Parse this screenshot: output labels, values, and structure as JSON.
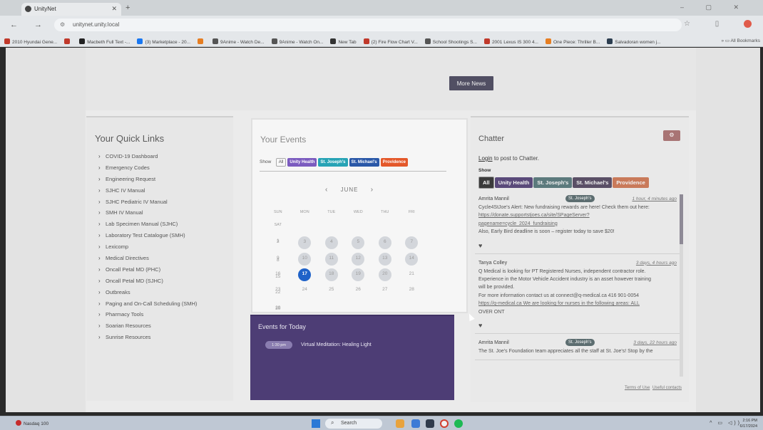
{
  "browser": {
    "tab_title": "UnityNet",
    "url": "unitynet.unity.local",
    "bookmarks": [
      {
        "label": "2010 Hyundai Gene...",
        "color": "#c0392b"
      },
      {
        "label": "",
        "color": "#c0392b"
      },
      {
        "label": "Macbeth Full Text -...",
        "color": "#222222"
      },
      {
        "label": "(3) Marketplace - 20...",
        "color": "#1877f2"
      },
      {
        "label": "",
        "color": "#e67e22"
      },
      {
        "label": "9Anime - Watch De...",
        "color": "#555555"
      },
      {
        "label": "9Anime - Watch On...",
        "color": "#555555"
      },
      {
        "label": "New Tab",
        "color": "#333333"
      },
      {
        "label": "(2) Fire Flow Chart V...",
        "color": "#c0392b"
      },
      {
        "label": "School Shootings S...",
        "color": "#555555"
      },
      {
        "label": "2001 Lexus IS 300 4...",
        "color": "#c0392b"
      },
      {
        "label": "One Piece: Thriller B...",
        "color": "#e67e22"
      },
      {
        "label": "Salvadoran women j...",
        "color": "#2c3e50"
      }
    ],
    "all_bookmarks_label": "All Bookmarks"
  },
  "news": {
    "more_news_label": "More News"
  },
  "quick_links": {
    "title": "Your Quick Links",
    "items": [
      "COVID-19 Dashboard",
      "Emergency Codes",
      "Engineering Request",
      "SJHC IV Manual",
      "SJHC Pediatric IV Manual",
      "SMH IV Manual",
      "Lab Specimen Manual (SJHC)",
      "Laboratory Test Catalogue (SMH)",
      "Lexicomp",
      "Medical Directives",
      "Oncall Petal MD (PHC)",
      "Oncall Petal MD (SJHC)",
      "Outbreaks",
      "Paging and On-Call Scheduling (SMH)",
      "Pharmacy Tools",
      "Soarian Resources",
      "Sunrise Resources"
    ]
  },
  "events": {
    "title": "Your Events",
    "show_label": "Show",
    "filters": [
      {
        "label": "All",
        "color": "#f8f8f8"
      },
      {
        "label": "Unity Health",
        "color": "#7b5bbf"
      },
      {
        "label": "St. Joseph's",
        "color": "#27a3b5"
      },
      {
        "label": "St. Michael's",
        "color": "#2a58a8"
      },
      {
        "label": "Providence",
        "color": "#e4582a"
      }
    ],
    "month": "JUNE",
    "prev": "‹",
    "next": "›",
    "weekdays": [
      "SUN",
      "MON",
      "TUE",
      "WED",
      "THU",
      "FRI",
      "SAT"
    ],
    "weeks": [
      [
        "",
        "",
        "",
        "",
        "",
        "",
        "1"
      ],
      [
        "2",
        "3",
        "4",
        "5",
        "6",
        "7",
        "8"
      ],
      [
        "9",
        "10",
        "11",
        "12",
        "13",
        "14",
        "15"
      ],
      [
        "16",
        "17",
        "18",
        "19",
        "20",
        "21",
        "22"
      ],
      [
        "23",
        "24",
        "25",
        "26",
        "27",
        "28",
        "29"
      ],
      [
        "30",
        "",
        "",
        "",
        "",
        "",
        ""
      ]
    ],
    "highlighted_days": [
      "3",
      "4",
      "5",
      "6",
      "7",
      "10",
      "11",
      "12",
      "13",
      "14",
      "18",
      "19",
      "20"
    ],
    "today": "17",
    "today_title": "Events for Today",
    "today_events": [
      {
        "time": "1:30 pm",
        "name": "Virtual Meditation: Healing Light"
      }
    ]
  },
  "chatter": {
    "title": "Chatter",
    "gear_icon": "gear-icon",
    "login_link": "Login",
    "login_suffix": "to post to Chatter.",
    "show_label": "Show",
    "filters": [
      {
        "label": "All",
        "color": "#3b3b3b"
      },
      {
        "label": "Unity Health",
        "color": "#5a4a7a"
      },
      {
        "label": "St. Joseph's",
        "color": "#5c7a7d"
      },
      {
        "label": "St. Michael's",
        "color": "#5a4f66"
      },
      {
        "label": "Providence",
        "color": "#c97a5a"
      }
    ],
    "posts": [
      {
        "author": "Amrita Mannil",
        "tag": "St. Joseph's",
        "time": "1 hour, 4 minutes ago",
        "lines": [
          "Cycle4StJoe's Alert: New fundraising rewards are here! Check them out here:",
          "https://donate.supportstjoes.ca/site/SPageServer?",
          "pagename=cycle_2024_fundraising",
          "Also, Early Bird deadline is soon – register today to save $20!"
        ]
      },
      {
        "author": "Tanya Colley",
        "tag": "",
        "time": "3 days, 4 hours ago",
        "lines": [
          "Q Medical is looking for PT Registered Nurses, independent contractor role.",
          "Experience in the Motor Vehicle Accident industry is an asset however training",
          "will be provided.",
          "For more information contact us at connect@q-medical.ca 416 901-0054",
          "https://q-medical.ca We are looking for nurses in the following areas: ALL",
          "OVER ONT"
        ]
      },
      {
        "author": "Amrita Mannil",
        "tag": "St. Joseph's",
        "time": "3 days, 22 hours ago",
        "lines": [
          "The St. Joe's Foundation team appreciates all the staff at St. Joe's! Stop by the"
        ]
      }
    ],
    "terms_label": "Terms of Use",
    "contacts_label": "Useful contacts"
  },
  "taskbar": {
    "ticker": "Nasdaq 100",
    "search_label": "Search",
    "time": "2:16 PM",
    "date": "6/17/2024"
  }
}
